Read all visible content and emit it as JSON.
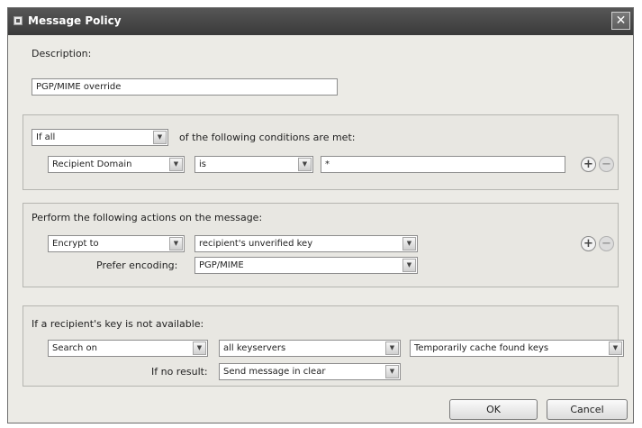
{
  "window": {
    "title": "Message Policy",
    "close_glyph": "✕"
  },
  "description": {
    "label": "Description:",
    "value": "PGP/MIME override"
  },
  "conditions": {
    "match_select": "If all",
    "match_text": "of the following conditions are met:",
    "row": {
      "field": "Recipient Domain",
      "operator": "is",
      "value": "*"
    }
  },
  "actions": {
    "heading": "Perform the following actions on the message:",
    "action": "Encrypt to",
    "target": "recipient's unverified key",
    "prefer_label": "Prefer encoding:",
    "prefer_value": "PGP/MIME"
  },
  "fallback": {
    "heading": "If a recipient's key is not available:",
    "action": "Search on",
    "servers": "all keyservers",
    "cache": "Temporarily cache found keys",
    "no_result_label": "If no result:",
    "no_result_value": "Send message in clear"
  },
  "buttons": {
    "ok": "OK",
    "cancel": "Cancel"
  },
  "icons": {
    "add": "+",
    "remove": "−",
    "dropdown": "▼"
  }
}
